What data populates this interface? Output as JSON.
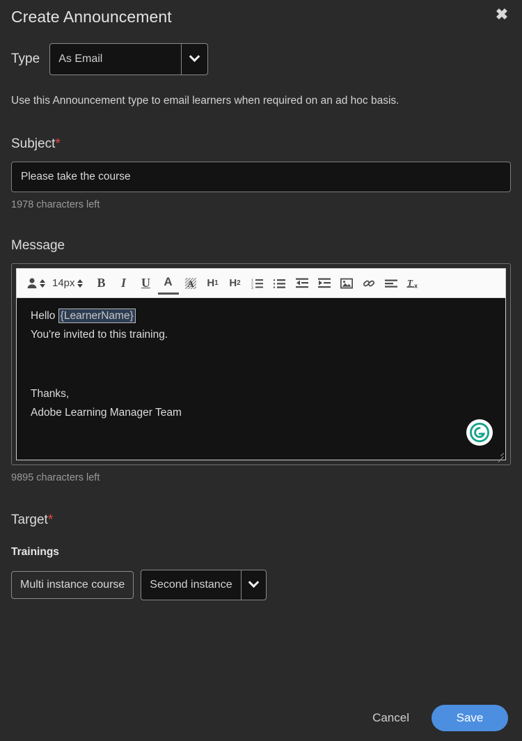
{
  "dialog": {
    "title": "Create Announcement",
    "close_icon": "close-icon"
  },
  "type_field": {
    "label": "Type",
    "value": "As Email",
    "options": [
      "As Email"
    ],
    "chevron_icon": "chevron-down-icon"
  },
  "helper_text": "Use this Announcement type to email learners when required on an ad hoc basis.",
  "subject_field": {
    "label": "Subject",
    "required_mark": "*",
    "value": "Please take the course",
    "placeholder": "",
    "characters_left": "1978 characters left"
  },
  "message_field": {
    "label": "Message",
    "characters_left": "9895 characters left",
    "toolbar": [
      {
        "name": "font-family-icon",
        "kind": "person-stepper",
        "label": ""
      },
      {
        "name": "font-size-stepper",
        "kind": "size-stepper",
        "label": "14px"
      },
      {
        "name": "bold-button",
        "kind": "bold",
        "label": "B"
      },
      {
        "name": "italic-button",
        "kind": "italic",
        "label": "I"
      },
      {
        "name": "underline-button",
        "kind": "underline",
        "label": "U"
      },
      {
        "name": "text-color-button",
        "kind": "fontcolor",
        "label": "A"
      },
      {
        "name": "highlight-color-button",
        "kind": "highlight",
        "label": "A"
      },
      {
        "name": "heading-1-button",
        "kind": "heading",
        "label": "H",
        "sub": "1"
      },
      {
        "name": "heading-2-button",
        "kind": "heading",
        "label": "H",
        "sub": "2"
      },
      {
        "name": "ordered-list-button",
        "kind": "ordered-list",
        "label": ""
      },
      {
        "name": "unordered-list-button",
        "kind": "unordered-list",
        "label": ""
      },
      {
        "name": "outdent-button",
        "kind": "outdent",
        "label": ""
      },
      {
        "name": "indent-button",
        "kind": "indent",
        "label": ""
      },
      {
        "name": "insert-image-button",
        "kind": "image",
        "label": ""
      },
      {
        "name": "insert-link-button",
        "kind": "link",
        "label": ""
      },
      {
        "name": "align-button",
        "kind": "align",
        "label": ""
      },
      {
        "name": "clear-format-button",
        "kind": "clear-format",
        "label": "T"
      }
    ],
    "content": {
      "greeting_prefix": "Hello ",
      "token": "{LearnerName}",
      "line2": "You're invited to this training.",
      "signoff": "Thanks,",
      "signature": "Adobe Learning Manager Team"
    },
    "grammarly_icon": "grammarly-icon"
  },
  "target_field": {
    "label": "Target",
    "required_mark": "*",
    "trainings_title": "Trainings",
    "training_chip": "Multi instance course",
    "instance_value": "Second instance",
    "instance_chevron_icon": "chevron-down-icon"
  },
  "footer": {
    "cancel_label": "Cancel",
    "save_label": "Save"
  },
  "colors": {
    "background": "#2a2a2a",
    "input_background": "#131313",
    "accent_blue": "#4c8fe0",
    "required_red": "#e8473f",
    "grammarly_green": "#15a18a",
    "token_highlight": "#2c3c52"
  }
}
